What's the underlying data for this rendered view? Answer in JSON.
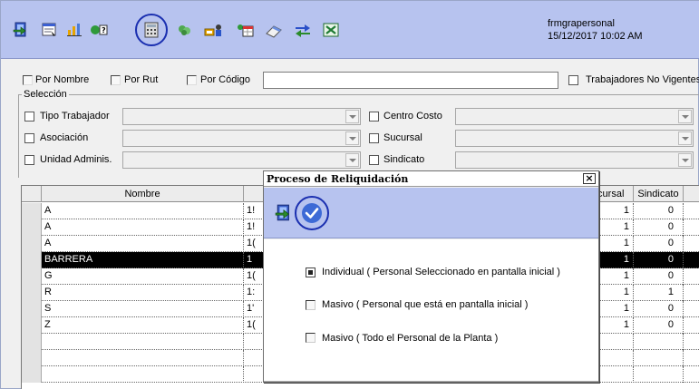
{
  "header": {
    "form_name": "frmgrapersonal",
    "datetime": "15/12/2017 10:02 AM"
  },
  "toolbar": {
    "icons": [
      "exit-icon",
      "report-icon",
      "chart-icon",
      "help-icon",
      "calculator-icon",
      "money-icon",
      "people-icon",
      "table-icon",
      "eraser-icon",
      "transfer-icon",
      "excel-icon"
    ]
  },
  "filters": {
    "por_nombre": "Por Nombre",
    "por_rut": "Por Rut",
    "por_codigo": "Por Código",
    "search_value": "",
    "trabajadores_no_vigentes": "Trabajadores No Vigentes"
  },
  "seleccion": {
    "title": "Selección",
    "left": [
      "Tipo Trabajador",
      "Asociación",
      "Unidad Adminis."
    ],
    "right": [
      "Centro Costo",
      "Sucursal",
      "Sindicato"
    ]
  },
  "grid": {
    "headers": {
      "nombre": "Nombre",
      "sucursal": "Sucursal",
      "sindicato": "Sindicato"
    },
    "rows": [
      {
        "nombre": "A",
        "code": "1!",
        "sucursal": "1",
        "sindicato": "0"
      },
      {
        "nombre": "A",
        "code": "1!",
        "sucursal": "1",
        "sindicato": "0"
      },
      {
        "nombre": "A",
        "code": "1(",
        "sucursal": "1",
        "sindicato": "0"
      },
      {
        "nombre": "BARRERA",
        "code": "1",
        "sucursal": "1",
        "sindicato": "0"
      },
      {
        "nombre": "G",
        "code": "1(",
        "sucursal": "1",
        "sindicato": "0"
      },
      {
        "nombre": "R",
        "code": "1:",
        "sucursal": "1",
        "sindicato": "1"
      },
      {
        "nombre": "S",
        "code": "1'",
        "sucursal": "1",
        "sindicato": "0"
      },
      {
        "nombre": "Z",
        "code": "1(",
        "sucursal": "1",
        "sindicato": "0"
      }
    ]
  },
  "dialog": {
    "title": "Proceso de Reliquidación",
    "close": "×",
    "options": [
      "Individual ( Personal Seleccionado en pantalla inicial )",
      "Masivo ( Personal que está en pantalla inicial )",
      "Masivo ( Todo el Personal de la Planta )"
    ],
    "selected_index": 0
  },
  "colors": {
    "toolbar_bg": "#b7c3ef",
    "highlight_circle": "#1a2fb0",
    "selected_row": "#000000"
  }
}
